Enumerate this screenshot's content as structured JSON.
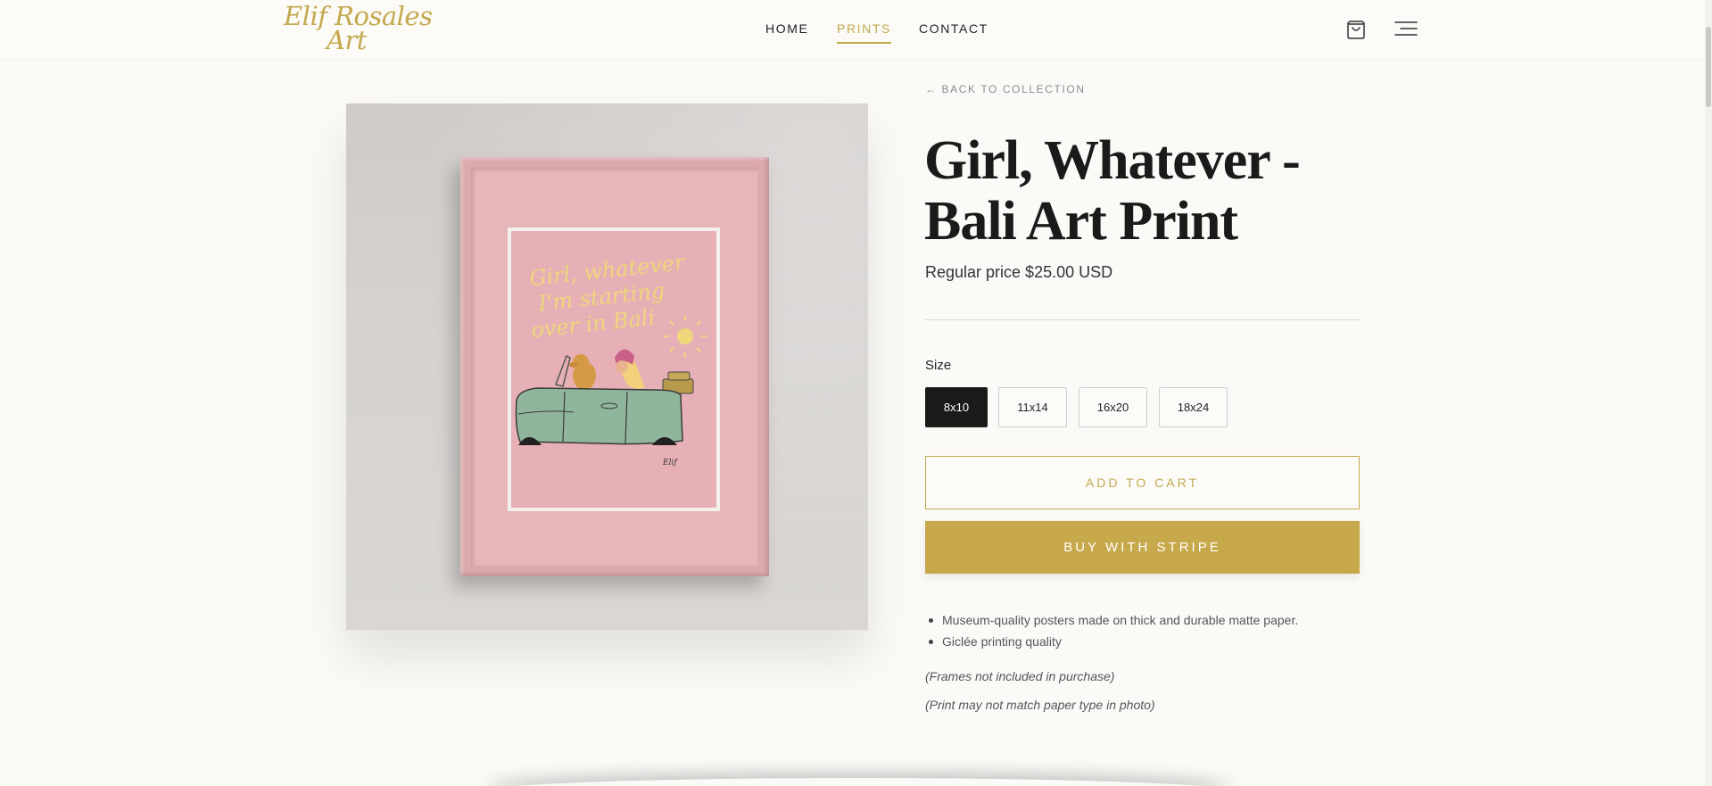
{
  "brand": {
    "logo_line1": "Elif Rosales",
    "logo_line2": "Art",
    "accent_color": "#c4a84e"
  },
  "nav": {
    "items": [
      {
        "label": "HOME",
        "active": false
      },
      {
        "label": "PRINTS",
        "active": true
      },
      {
        "label": "CONTACT",
        "active": false
      }
    ]
  },
  "header_icons": {
    "cart": "cart-icon",
    "menu": "menu-icon"
  },
  "product": {
    "back_link": "← BACK TO COLLECTION",
    "title": "Girl, Whatever - Bali Art Print",
    "price": "Regular price $25.00 USD",
    "size_label": "Size",
    "sizes": [
      "8x10",
      "11x14",
      "16x20",
      "18x24"
    ],
    "selected_size": "8x10",
    "add_to_cart": "ADD TO CART",
    "buy_button": "BUY WITH STRIPE",
    "features": [
      "Museum-quality posters made on thick and durable matte paper.",
      "Giclée printing quality"
    ],
    "notes": [
      "(Frames not included in purchase)",
      "(Print may not match paper type in photo)"
    ]
  },
  "artwork": {
    "lettering_line1": "Girl, whatever",
    "lettering_line2": "I'm starting",
    "lettering_line3": "over in Bali",
    "signature": "Elif"
  }
}
